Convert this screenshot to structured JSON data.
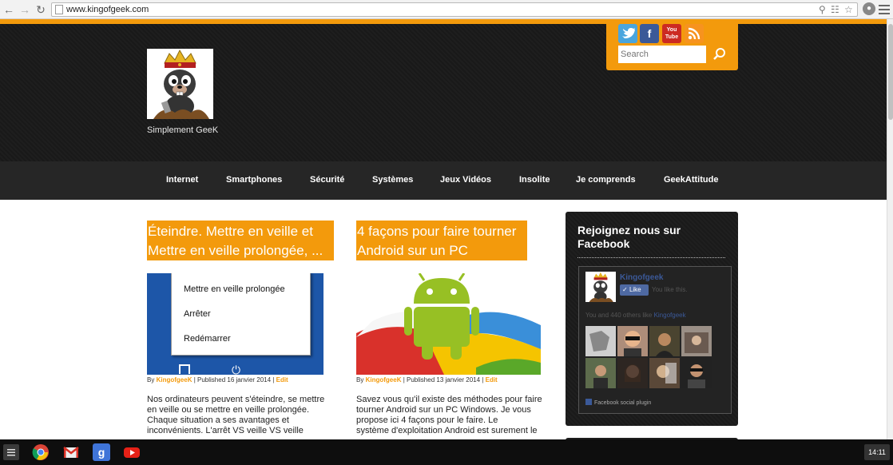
{
  "browser": {
    "url": "www.kingofgeek.com"
  },
  "header": {
    "tagline": "Simplement GeeK",
    "social": [
      {
        "icon": "twitter-icon",
        "color": "#4aa5dd"
      },
      {
        "icon": "facebook-icon",
        "color": "#3b5998"
      },
      {
        "icon": "youtube-icon",
        "color": "#cc2a22",
        "label": "You Tube"
      },
      {
        "icon": "rss-icon",
        "color": "#f7931e"
      }
    ],
    "search_placeholder": "Search"
  },
  "nav": {
    "items": [
      "Internet",
      "Smartphones",
      "Sécurité",
      "Systèmes",
      "Jeux Vidéos",
      "Insolite",
      "Je comprends",
      "GeekAttitude"
    ]
  },
  "posts": [
    {
      "title_lines": [
        "Éteindre. Mettre en veille et",
        "Mettre en veille prolongée, ..."
      ],
      "menu_items": [
        "Mettre en veille prolongée",
        "Arrêter",
        "Redémarrer"
      ],
      "meta": {
        "by": "By",
        "author": "KingofgeeK",
        "published": "| Published 16 janvier 2014 |",
        "edit": "Edit"
      },
      "excerpt_lines": [
        "Nos ordinateurs peuvent s'éteindre, se mettre",
        "en veille ou se mettre en veille prolongée.",
        "Chaque situation a ses avantages et",
        "inconvénients.     L'arrêt VS veille VS veille"
      ]
    },
    {
      "title_lines": [
        "4 façons pour faire tourner",
        "Android sur un PC"
      ],
      "meta": {
        "by": "By",
        "author": "KingofgeeK",
        "published": "| Published 13 janvier 2014 |",
        "edit": "Edit"
      },
      "excerpt_lines": [
        "Savez vous qu'il existe des méthodes pour faire",
        "tourner Android sur un PC Windows. Je vous",
        "propose ici 4 façons pour le faire.     Le",
        "système d'exploitation Android est surement le"
      ]
    }
  ],
  "sidebar": {
    "title": "Rejoignez nous sur Facebook",
    "fb": {
      "page_name": "Kingofgeek",
      "like_label": "Like",
      "likes_text": "You like this.",
      "friends_prefix": "You and 440 others like",
      "friends_link": "Kingofgeek",
      "plugin_label": "Facebook social plugin"
    }
  },
  "taskbar": {
    "clock": "14:11",
    "apps": [
      "chrome-icon",
      "gmail-icon",
      "google-search-icon",
      "youtube-icon"
    ]
  }
}
